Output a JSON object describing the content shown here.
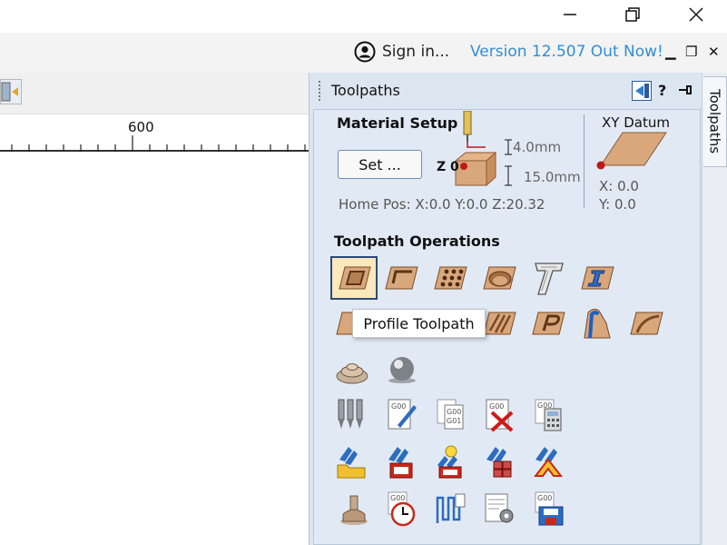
{
  "window": {
    "controls": {
      "minimize": "minimize-icon",
      "restore": "restore-icon",
      "close": "close-icon"
    }
  },
  "toprow": {
    "signin_label": "Sign in...",
    "version_label": "Version 12.507 Out Now!",
    "mdi_min": "▁",
    "mdi_restore": "❐",
    "mdi_close": "✕"
  },
  "ruler": {
    "label": "600"
  },
  "panel": {
    "title": "Toolpaths",
    "side_tab": "Toolpaths",
    "help": "?",
    "material": {
      "heading": "Material Setup",
      "set_button": "Set ...",
      "z_label": "Z 0",
      "dim_top": "4.0mm",
      "dim_thickness": "15.0mm",
      "home_pos": "Home Pos:   X:0.0 Y:0.0 Z:20.32"
    },
    "datum": {
      "heading": "XY Datum",
      "x": "X: 0.0",
      "y": "Y: 0.0"
    },
    "operations_heading": "Toolpath Operations",
    "tooltip": "Profile Toolpath"
  },
  "colors": {
    "panel_bg": "#e1eaf4",
    "link": "#2f8ed8",
    "wood": "#d9a77c",
    "selected_fill": "#fbe9bd"
  }
}
